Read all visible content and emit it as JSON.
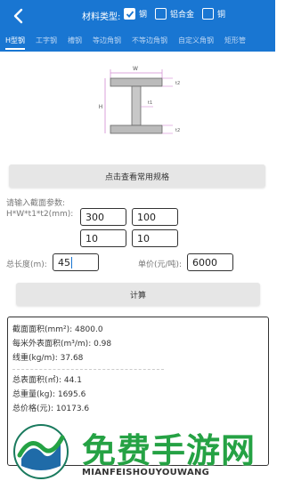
{
  "header": {
    "material_label": "材料类型:",
    "options": [
      {
        "label": "钢",
        "checked": true
      },
      {
        "label": "铝合金",
        "checked": false
      },
      {
        "label": "铜",
        "checked": false
      }
    ],
    "colors": {
      "primary": "#1976D2"
    }
  },
  "tabs": [
    "H型钢",
    "工字钢",
    "槽钢",
    "等边角钢",
    "不等边角钢",
    "自定义角钢",
    "矩形管"
  ],
  "diagram": {
    "w_label": "W",
    "h_label": "H",
    "t1_label": "t1",
    "t2_label": "t2"
  },
  "view_specs_button": "点击查看常用规格",
  "section": {
    "prompt": "请输入截面参数:",
    "param_label": "H*W*t1*t2(mm):",
    "values": [
      "300",
      "100",
      "10",
      "10"
    ]
  },
  "length": {
    "label": "总长度(m):",
    "value": "45"
  },
  "price": {
    "label": "单价(元/吨):",
    "value": "6000"
  },
  "calc_button": "计算",
  "results": {
    "lines1": [
      "截面面积(mm²): 4800.0",
      "每米外表面积(m³/m): 0.98",
      "线重(kg/m): 37.68"
    ],
    "lines2": [
      "总表面积(㎡): 44.1",
      "总重量(kg): 1695.6",
      "总价格(元): 10173.6"
    ]
  },
  "watermark": {
    "title": "免费手游网",
    "subtitle": "MIANFEISHOUYOUWANG"
  }
}
